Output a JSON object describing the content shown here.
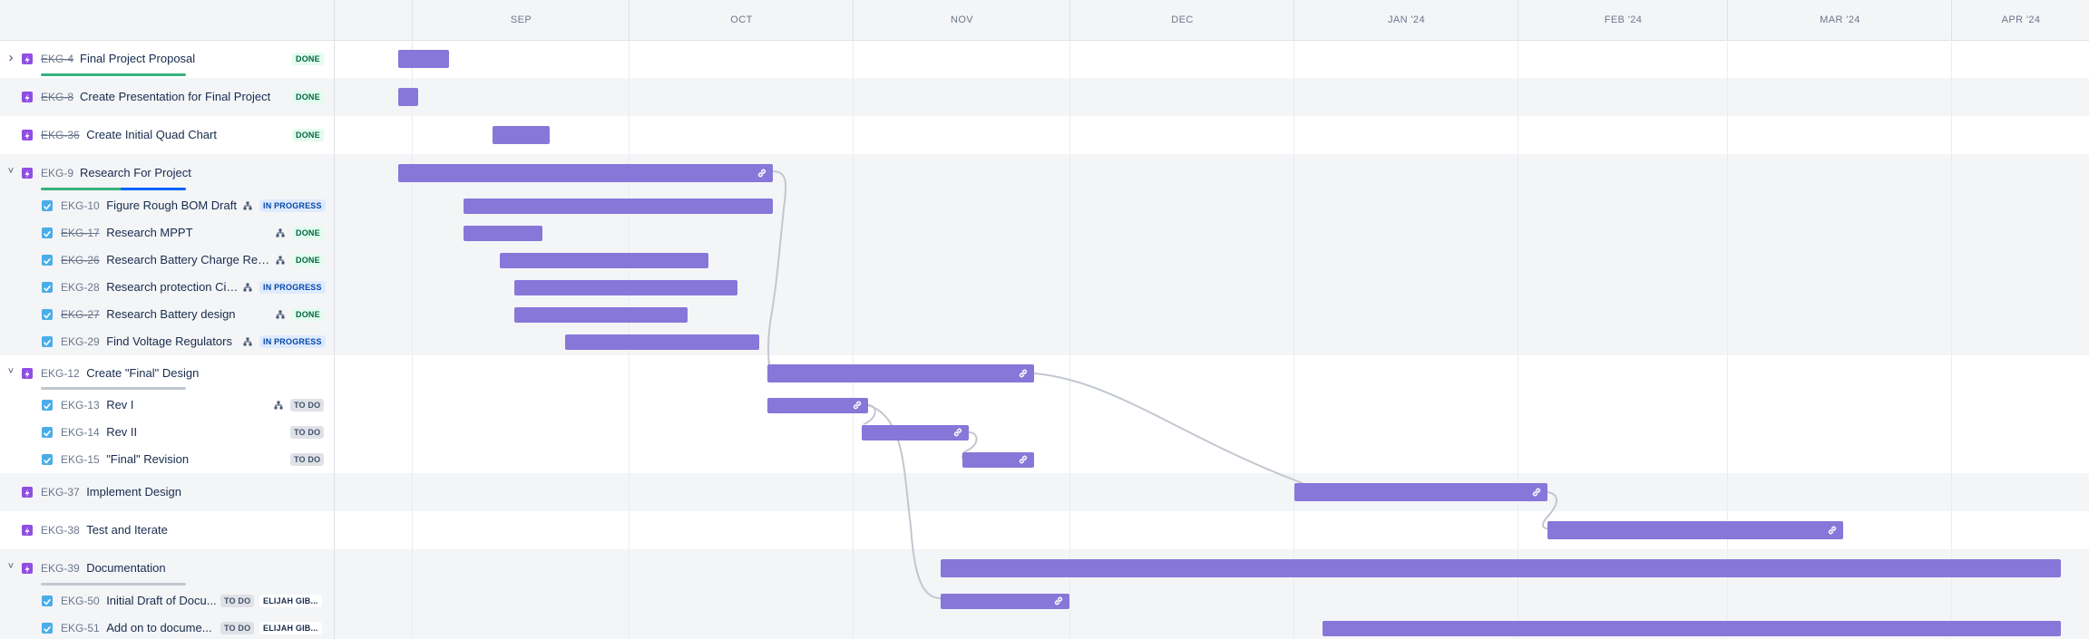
{
  "months": [
    {
      "label": "SEP"
    },
    {
      "label": "OCT"
    },
    {
      "label": "NOV"
    },
    {
      "label": "DEC"
    },
    {
      "label": "JAN '24"
    },
    {
      "label": "FEB '24"
    },
    {
      "label": "MAR '24"
    },
    {
      "label": "APR '24"
    }
  ],
  "rows": [
    {
      "key": "EKG-4",
      "summary": "Final Project Proposal",
      "status": "DONE",
      "type": "epic",
      "done": true,
      "chevron": "›"
    },
    {
      "key": "EKG-8",
      "summary": "Create Presentation for Final Project",
      "status": "DONE",
      "type": "epic",
      "done": true
    },
    {
      "key": "EKG-36",
      "summary": "Create Initial Quad Chart",
      "status": "DONE",
      "type": "epic",
      "done": true
    },
    {
      "key": "EKG-9",
      "summary": "Research For Project",
      "type": "epic",
      "done": false,
      "chevron": "˅"
    },
    {
      "key": "EKG-10",
      "summary": "Figure Rough BOM Draft",
      "status": "IN PROGRESS",
      "type": "task",
      "done": false
    },
    {
      "key": "EKG-17",
      "summary": "Research MPPT",
      "status": "DONE",
      "type": "task",
      "done": true
    },
    {
      "key": "EKG-26",
      "summary": "Research Battery Charge Reg...",
      "status": "DONE",
      "type": "task",
      "done": true
    },
    {
      "key": "EKG-28",
      "summary": "Research protection Cir...",
      "status": "IN PROGRESS",
      "type": "task",
      "done": false
    },
    {
      "key": "EKG-27",
      "summary": "Research Battery design",
      "status": "DONE",
      "type": "task",
      "done": true
    },
    {
      "key": "EKG-29",
      "summary": "Find Voltage Regulators",
      "status": "IN PROGRESS",
      "type": "task",
      "done": false
    },
    {
      "key": "EKG-12",
      "summary": "Create \"Final\" Design",
      "type": "epic",
      "done": false,
      "chevron": "˅"
    },
    {
      "key": "EKG-13",
      "summary": "Rev I",
      "status": "TO DO",
      "type": "task",
      "done": false
    },
    {
      "key": "EKG-14",
      "summary": "Rev II",
      "status": "TO DO",
      "type": "task",
      "done": false
    },
    {
      "key": "EKG-15",
      "summary": "\"Final\" Revision",
      "status": "TO DO",
      "type": "task",
      "done": false
    },
    {
      "key": "EKG-37",
      "summary": "Implement Design",
      "type": "epic",
      "done": false
    },
    {
      "key": "EKG-38",
      "summary": "Test and Iterate",
      "type": "epic",
      "done": false
    },
    {
      "key": "EKG-39",
      "summary": "Documentation",
      "type": "epic",
      "done": false,
      "chevron": "˅"
    },
    {
      "key": "EKG-50",
      "summary": "Initial Draft of Docu...",
      "status": "TO DO",
      "type": "task",
      "done": false,
      "assignee": "ELIJAH GIB..."
    },
    {
      "key": "EKG-51",
      "summary": "Add on to docume...",
      "status": "TO DO",
      "type": "task",
      "done": false,
      "assignee": "ELIJAH GIB..."
    }
  ],
  "colors": {
    "bar": "#8777d9",
    "epic_icon": "#904ee2",
    "task_icon": "#4bade8",
    "progress_done": "#36b37e",
    "progress_partial": "#0065ff",
    "progress_empty": "#c1c7d0"
  },
  "icons": {
    "expand": "chevron-right-icon",
    "collapse": "chevron-down-icon",
    "epic": "epic-lightning-icon",
    "task": "checkbox-task-icon",
    "child": "child-issues-icon",
    "dependency": "link-icon"
  }
}
